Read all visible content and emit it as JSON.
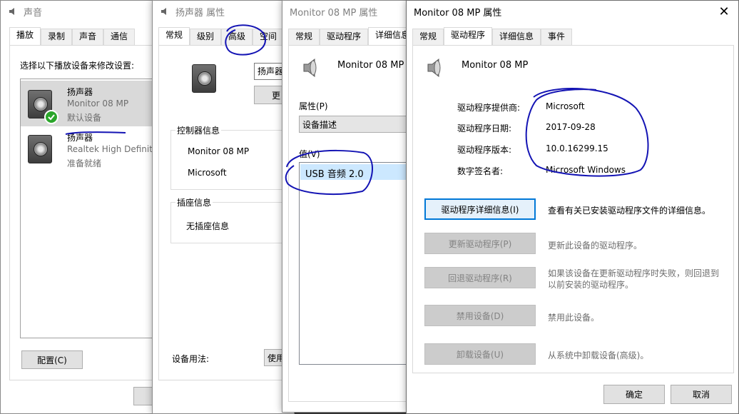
{
  "sound": {
    "title": "声音",
    "tabs": [
      "播放",
      "录制",
      "声音",
      "通信"
    ],
    "instruction": "选择以下播放设备来修改设置:",
    "devices": [
      {
        "name": "扬声器",
        "detail": "Monitor 08 MP",
        "status": "默认设备"
      },
      {
        "name": "扬声器",
        "detail": "Realtek High Definiti",
        "status": "准备就绪"
      }
    ],
    "configure_btn": "配置(C)"
  },
  "speaker_props": {
    "title": "扬声器 属性",
    "tabs": [
      "常规",
      "级别",
      "高级",
      "空间"
    ],
    "name_value": "扬声器",
    "change_btn": "更",
    "controller_group": "控制器信息",
    "controller_name": "Monitor 08 MP",
    "controller_vendor": "Microsoft",
    "jack_group": "插座信息",
    "jack_info": "无插座信息",
    "usage_label": "设备用法:",
    "usage_value": "使用"
  },
  "monitor_details": {
    "title": "Monitor 08 MP 属性",
    "tabs": [
      "常规",
      "驱动程序",
      "详细信息"
    ],
    "device_name": "Monitor 08 MP",
    "property_label": "属性(P)",
    "property_value": "设备描述",
    "value_label": "值(V)",
    "value_item": "USB 音频 2.0"
  },
  "monitor_driver": {
    "title": "Monitor 08 MP 属性",
    "tabs": [
      "常规",
      "驱动程序",
      "详细信息",
      "事件"
    ],
    "device_name": "Monitor 08 MP",
    "fields": [
      {
        "label": "驱动程序提供商:",
        "value": "Microsoft"
      },
      {
        "label": "驱动程序日期:",
        "value": "2017-09-28"
      },
      {
        "label": "驱动程序版本:",
        "value": "10.0.16299.15"
      },
      {
        "label": "数字签名者:",
        "value": "Microsoft Windows"
      }
    ],
    "actions": [
      {
        "button": "驱动程序详细信息(I)",
        "desc": "查看有关已安装驱动程序文件的详细信息。"
      },
      {
        "button": "更新驱动程序(P)",
        "desc": "更新此设备的驱动程序。"
      },
      {
        "button": "回退驱动程序(R)",
        "desc": "如果该设备在更新驱动程序时失败，则回退到以前安装的驱动程序。"
      },
      {
        "button": "禁用设备(D)",
        "desc": "禁用此设备。"
      },
      {
        "button": "卸载设备(U)",
        "desc": "从系统中卸载设备(高级)。"
      }
    ],
    "ok_btn": "确定",
    "cancel_btn": "取消"
  },
  "colors": {
    "accent": "#0078d7",
    "annotation": "#1414b4",
    "selected": "#cce8ff"
  }
}
